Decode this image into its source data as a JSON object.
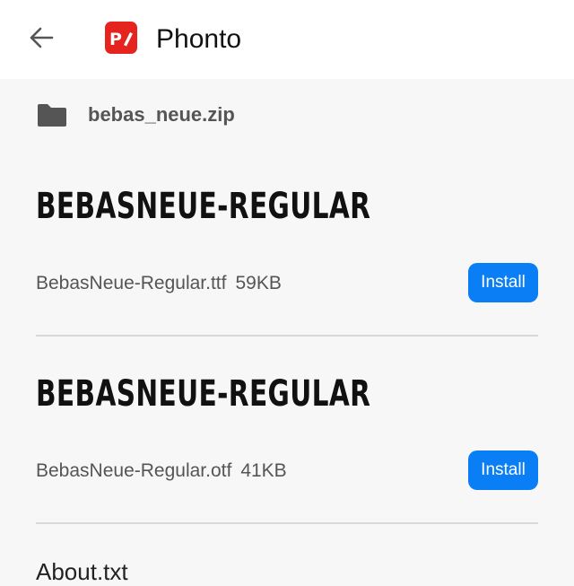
{
  "header": {
    "back_icon": "arrow-left-icon",
    "app_icon": "phonto-app-icon",
    "app_icon_color": "#e5241f",
    "app_icon_text": "P",
    "title": "Phonto"
  },
  "archive": {
    "icon": "folder-icon",
    "name": "bebas_neue.zip"
  },
  "fonts": [
    {
      "preview": "BEBASNEUE-REGULAR",
      "filename": "BebasNeue-Regular.ttf",
      "size": "59KB",
      "install_label": "Install"
    },
    {
      "preview": "BEBASNEUE-REGULAR",
      "filename": "BebasNeue-Regular.otf",
      "size": "41KB",
      "install_label": "Install"
    }
  ],
  "about": {
    "label": "About.txt"
  },
  "colors": {
    "accent": "#0a7ff5",
    "background": "#f7f7f7"
  }
}
